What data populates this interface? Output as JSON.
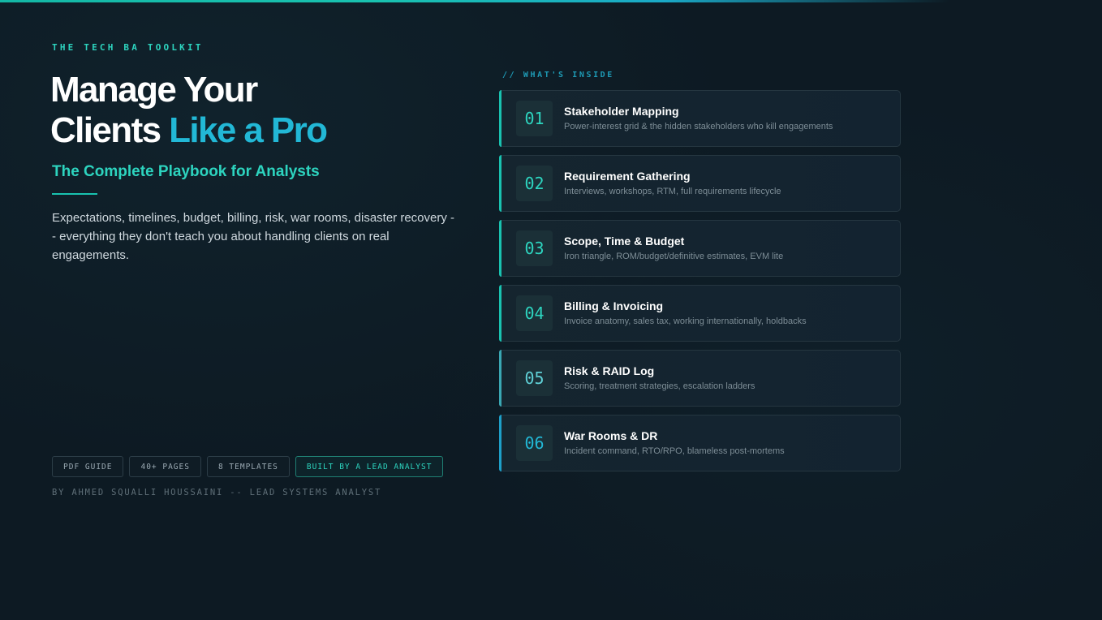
{
  "kicker": "THE TECH BA TOOLKIT",
  "headline": {
    "line1": "Manage Your",
    "line2_plain": "Clients ",
    "line2_accent": "Like a Pro"
  },
  "subhead": "The Complete Playbook for Analysts",
  "description": "Expectations, timelines, budget, billing, risk, war rooms, disaster recovery -- everything they don't teach you about handling clients on real engagements.",
  "badges": [
    "PDF GUIDE",
    "40+ PAGES",
    "8 TEMPLATES",
    "BUILT BY A LEAD ANALYST"
  ],
  "byline": "BY AHMED SQUALLI HOUSSAINI -- LEAD SYSTEMS ANALYST",
  "section_label": "// WHAT'S INSIDE",
  "items": [
    {
      "num": "01",
      "title": "Stakeholder Mapping",
      "desc": "Power-interest grid & the hidden stakeholders who kill engagements"
    },
    {
      "num": "02",
      "title": "Requirement Gathering",
      "desc": "Interviews, workshops, RTM, full requirements lifecycle"
    },
    {
      "num": "03",
      "title": "Scope, Time & Budget",
      "desc": "Iron triangle, ROM/budget/definitive estimates, EVM lite"
    },
    {
      "num": "04",
      "title": "Billing & Invoicing",
      "desc": "Invoice anatomy, sales tax, working internationally, holdbacks"
    },
    {
      "num": "05",
      "title": "Risk & RAID Log",
      "desc": "Scoring, treatment strategies, escalation ladders"
    },
    {
      "num": "06",
      "title": "War Rooms & DR",
      "desc": "Incident command, RTO/RPO, blameless post-mortems"
    }
  ],
  "colors": {
    "background": "#0d1a23",
    "teal_accent": "#2dd4bf",
    "blue_accent": "#22b8d6"
  }
}
